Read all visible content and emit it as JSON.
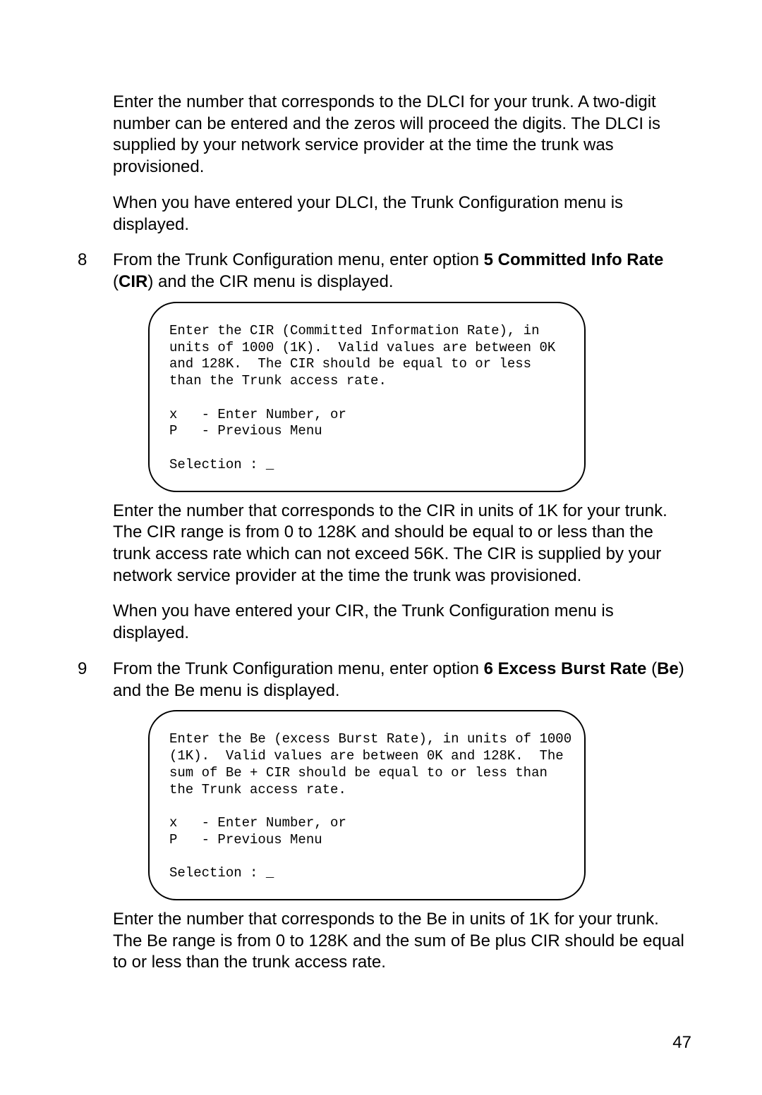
{
  "para1": "Enter the number that corresponds to the DLCI for your trunk.   A two-digit number can be entered and the zeros will proceed the digits.  The DLCI is supplied by your network service provider at the time the trunk was provisioned.",
  "para2": "When you have entered your DLCI, the Trunk Configuration menu is displayed.",
  "step8": {
    "num": "8",
    "lead": "From the Trunk Configuration menu, enter option ",
    "bold1": "5 Committed Info Rate",
    "mid": " (",
    "bold2": "CIR",
    "tail": ") and the CIR menu is displayed."
  },
  "term1": "Enter the CIR (Committed Information Rate), in\nunits of 1000 (1K).  Valid values are between 0K\nand 128K.  The CIR should be equal to or less\nthan the Trunk access rate.\n\nx   - Enter Number, or\nP   - Previous Menu\n\nSelection : _",
  "para3": "Enter the number that corresponds to the CIR in units of 1K for your trunk.  The CIR range is from 0 to 128K and should be equal to or less than the trunk access rate which can not exceed 56K.  The CIR is supplied by your network service provider at the time the trunk was provisioned.",
  "para4": "When you have entered your CIR, the Trunk Configuration menu is displayed.",
  "step9": {
    "num": "9",
    "lead": "From the Trunk Configuration menu, enter option ",
    "bold1": "6 Excess Burst Rate",
    "mid": " (",
    "bold2": "Be",
    "tail": ") and the Be menu is displayed."
  },
  "term2": "Enter the Be (excess Burst Rate), in units of 1000\n(1K).  Valid values are between 0K and 128K.  The\nsum of Be + CIR should be equal to or less than\nthe Trunk access rate.\n\nx   - Enter Number, or\nP   - Previous Menu\n\nSelection : _",
  "para5": "Enter the number that corresponds to the Be in units of 1K for your trunk.  The Be range is from 0 to 128K and the sum of Be plus CIR should be equal to or less than the trunk access rate.",
  "pageNumber": "47"
}
